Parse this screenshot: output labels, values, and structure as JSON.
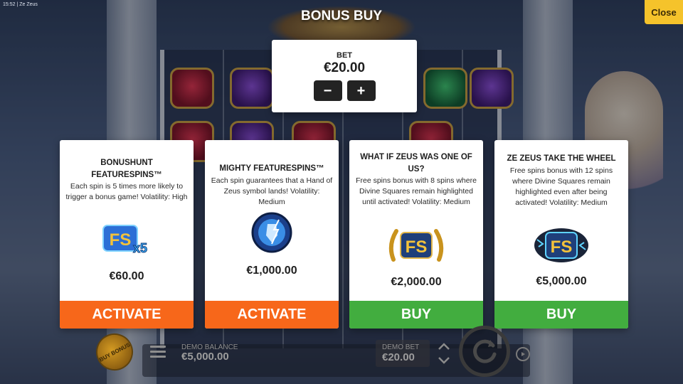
{
  "status_bar": {
    "clock": "15:52 | Ze Zeus"
  },
  "header": {
    "title": "BONUS BUY",
    "close_label": "Close"
  },
  "bet_panel": {
    "label": "BET",
    "value": "€20.00",
    "decrease_symbol": "−",
    "increase_symbol": "+"
  },
  "cards": [
    {
      "title": "BONUSHUNT FEATURESPINS™",
      "description": "Each spin is 5 times more likely to trigger a bonus game! Volatility: High",
      "icon": "fs-x5-icon",
      "price": "€60.00",
      "button_label": "ACTIVATE",
      "button_color": "#f7671a"
    },
    {
      "title": "MIGHTY FEATURESPINS™",
      "description": "Each spin guarantees that a Hand of Zeus symbol lands! Volatility: Medium",
      "icon": "hand-of-zeus-icon",
      "price": "€1,000.00",
      "button_label": "ACTIVATE",
      "button_color": "#f7671a"
    },
    {
      "title": "WHAT IF ZEUS WAS ONE OF US?",
      "description": "Free spins bonus with 8 spins where Divine Squares remain highlighted until activated! Volatility: Medium",
      "icon": "fs-laurel-icon",
      "price": "€2,000.00",
      "button_label": "BUY",
      "button_color": "#42ad3f"
    },
    {
      "title": "ZE ZEUS TAKE THE WHEEL",
      "description": "Free spins bonus with 12 spins where Divine Squares remain highlighted even after being activated! Volatility: Medium",
      "icon": "fs-lightning-cloud-icon",
      "price": "€5,000.00",
      "button_label": "BUY",
      "button_color": "#42ad3f"
    }
  ],
  "bottom_bar": {
    "buy_bonus_label": "BUY BONUS",
    "balance_label": "DEMO BALANCE",
    "balance_value": "€5,000.00",
    "bet_label": "DEMO BET",
    "bet_value": "€20.00"
  },
  "colors": {
    "close_button": "#f5c32b",
    "activate_button": "#f7671a",
    "buy_button": "#42ad3f"
  }
}
